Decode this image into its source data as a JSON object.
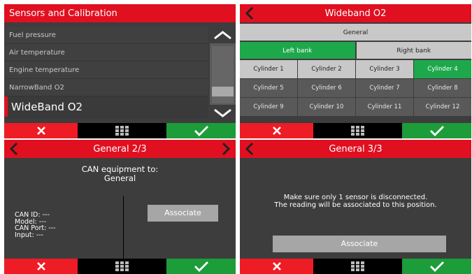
{
  "panel1": {
    "title": "Sensors and Calibration",
    "items": [
      "Fuel pressure",
      "Air temperature",
      "Engine temperature",
      "NarrowBand O2"
    ],
    "selected_item": "WideBand O2"
  },
  "panel2": {
    "title": "Wideband O2",
    "general_label": "General",
    "banks": [
      "Left bank",
      "Right bank"
    ],
    "cylinders": [
      [
        "Cylinder 1",
        "Cylinder 2",
        "Cylinder 3",
        "Cylinder 4"
      ],
      [
        "Cylinder 5",
        "Cylinder 6",
        "Cylinder 7",
        "Cylinder 8"
      ],
      [
        "Cylinder 9",
        "Cylinder 10",
        "Cylinder 11",
        "Cylinder 12"
      ]
    ]
  },
  "panel3": {
    "title": "General 2/3",
    "heading_line1": "CAN equipment to:",
    "heading_line2": "General",
    "info": [
      "CAN ID: ---",
      "Model: ---",
      "CAN Port: ---",
      "Input: ---"
    ],
    "associate_label": "Associate"
  },
  "panel4": {
    "title": "General 3/3",
    "message_line1": "Make sure only 1 sensor is disconnected.",
    "message_line2": "The reading will be associated to this position.",
    "associate_label": "Associate"
  },
  "icons": {
    "cancel": "close-icon",
    "menu": "grid-icon",
    "confirm": "check-icon",
    "back": "chevron-left-icon",
    "next": "chevron-right-icon",
    "scroll_up": "chevron-up-icon",
    "scroll_down": "chevron-down-icon"
  },
  "colors": {
    "accent_red": "#e01020",
    "cancel_red": "#ee1c25",
    "confirm_green": "#1d9c3a",
    "selected_green": "#1ea84c",
    "panel_bg": "#3d3d3d"
  }
}
